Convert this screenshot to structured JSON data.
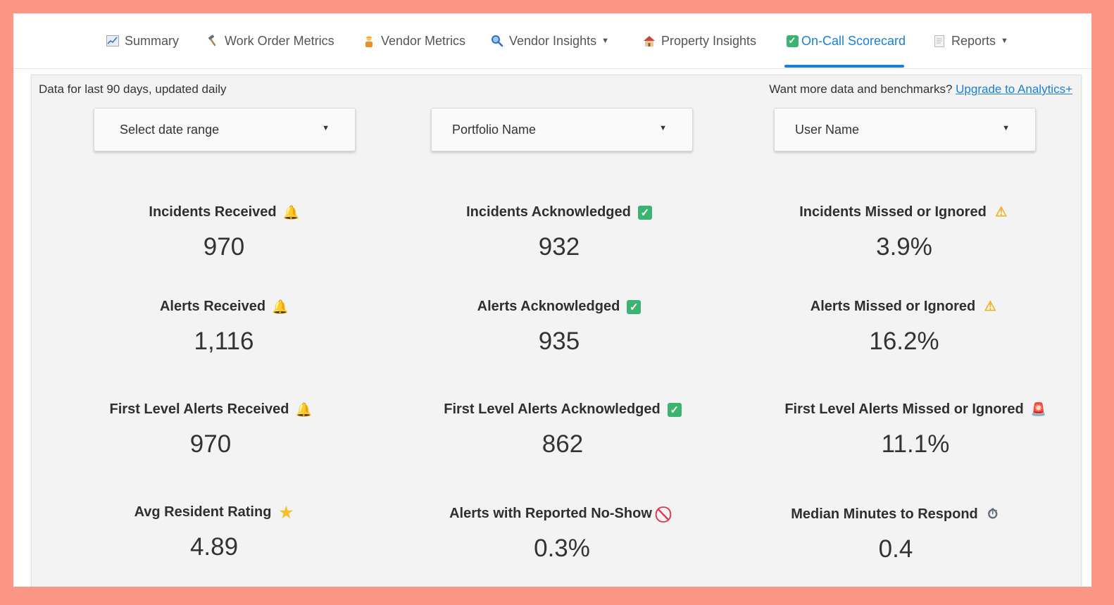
{
  "nav": {
    "tabs": [
      {
        "label": "Summary",
        "icon": "chart-icon"
      },
      {
        "label": "Work Order Metrics",
        "icon": "hammer-icon"
      },
      {
        "label": "Vendor Metrics",
        "icon": "worker-icon"
      },
      {
        "label": "Vendor Insights",
        "icon": "magnifier-icon",
        "dropdown": true
      },
      {
        "label": "Property Insights",
        "icon": "house-icon"
      },
      {
        "label": "On-Call Scorecard",
        "icon": "checkbox-icon",
        "active": true
      },
      {
        "label": "Reports",
        "icon": "document-icon",
        "dropdown": true
      }
    ],
    "active_color": "#1a7fd6"
  },
  "panel": {
    "note": "Data for last 90 days, updated daily",
    "upsell_text": "Want more data and benchmarks?",
    "upsell_link": "Upgrade to Analytics+"
  },
  "filters": {
    "date_range": "Select date range",
    "portfolio": "Portfolio Name",
    "user": "User Name"
  },
  "metrics": {
    "incidents_received": {
      "label": "Incidents Received",
      "value": "970",
      "icon": "bell-icon"
    },
    "incidents_acknowledged": {
      "label": "Incidents Acknowledged",
      "value": "932",
      "icon": "check-icon"
    },
    "incidents_missed": {
      "label": "Incidents Missed or Ignored",
      "value": "3.9%",
      "icon": "warning-icon"
    },
    "alerts_received": {
      "label": "Alerts Received",
      "value": "1,116",
      "icon": "bell-icon"
    },
    "alerts_acknowledged": {
      "label": "Alerts Acknowledged",
      "value": "935",
      "icon": "check-icon"
    },
    "alerts_missed": {
      "label": "Alerts Missed or Ignored",
      "value": "16.2%",
      "icon": "warning-icon"
    },
    "first_received": {
      "label": "First Level Alerts Received",
      "value": "970",
      "icon": "bell-icon"
    },
    "first_acknowledged": {
      "label": "First Level Alerts Acknowledged",
      "value": "862",
      "icon": "check-icon"
    },
    "first_missed": {
      "label": "First Level Alerts Missed or Ignored",
      "value": "11.1%",
      "icon": "siren-icon"
    },
    "avg_rating": {
      "label": "Avg Resident Rating",
      "value": "4.89",
      "icon": "star-icon"
    },
    "no_show": {
      "label": "Alerts with Reported No-Show",
      "value": "0.3%",
      "icon": "no-entry-icon"
    },
    "median_minutes": {
      "label": "Median Minutes to Respond",
      "value": "0.4",
      "icon": "stopwatch-icon"
    }
  }
}
